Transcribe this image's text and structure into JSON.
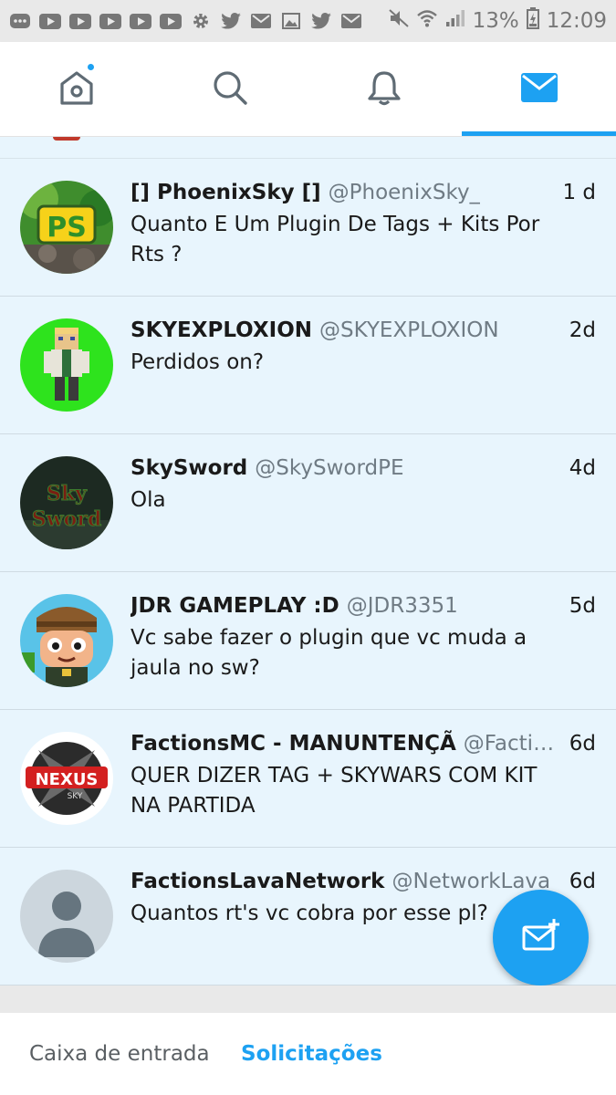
{
  "status": {
    "battery": "13%",
    "time": "12:09"
  },
  "colors": {
    "accent": "#1da1f2",
    "list_bg": "#e8f5fd"
  },
  "tabs": [
    {
      "icon": "home-icon",
      "active": false,
      "badge": true
    },
    {
      "icon": "search-icon",
      "active": false
    },
    {
      "icon": "bell-icon",
      "active": false
    },
    {
      "icon": "mail-icon",
      "active": true
    }
  ],
  "conversations": [
    {
      "name": "[] PhoenixSky []",
      "handle": "@PhoenixSky_",
      "time": "1 d",
      "message": "Quanto E Um Plugin De Tags + Kits Por Rts ?",
      "avatar_text": "PS"
    },
    {
      "name": "SKYEXPLOXION",
      "handle": "@SKYEXPLOXION",
      "time": "2d",
      "message": "Perdidos on?"
    },
    {
      "name": "SkySword",
      "handle": "@SkySwordPE",
      "time": "4d",
      "message": "Ola",
      "avatar_text": "Sky Sword"
    },
    {
      "name": "JDR GAMEPLAY :D",
      "handle": "@JDR3351",
      "time": "5d",
      "message": "Vc sabe fazer o plugin que vc muda a jaula no sw?"
    },
    {
      "name": "FactionsMC - MANUNTENÇÃ",
      "handle": "@Factions...",
      "time": "6d",
      "message": "QUER DIZER TAG + SKYWARS COM KIT NA PARTIDA",
      "avatar_text": "NEXUS"
    },
    {
      "name": "FactionsLavaNetwork",
      "handle": "@NetworkLava",
      "time": "6d",
      "message": "Quantos rt's vc cobra por esse pl?"
    }
  ],
  "bottom_tabs": {
    "inbox": "Caixa de entrada",
    "requests": "Solicitações"
  }
}
